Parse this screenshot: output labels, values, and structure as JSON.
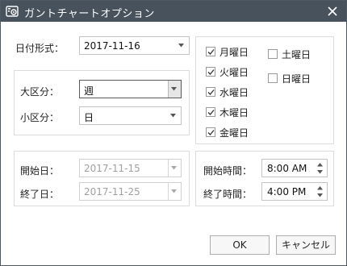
{
  "window": {
    "title": "ガントチャートオプション",
    "icon": "gantt-settings-icon"
  },
  "date_format": {
    "label": "日付形式：",
    "value": "2017-11-16"
  },
  "divisions": {
    "major_label": "大区分：",
    "major_value": "週",
    "minor_label": "小区分：",
    "minor_value": "日"
  },
  "weekdays": {
    "monday": "月曜日",
    "tuesday": "火曜日",
    "wednesday": "水曜日",
    "thursday": "木曜日",
    "friday": "金曜日",
    "saturday": "土曜日",
    "sunday": "日曜日"
  },
  "dates": {
    "start_label": "開始日：",
    "start_value": "2017-11-15",
    "end_label": "終了日：",
    "end_value": "2017-11-25"
  },
  "times": {
    "start_label": "開始時間：",
    "start_value": "8:00 AM",
    "end_label": "終了時間：",
    "end_value": "4:00 PM"
  },
  "buttons": {
    "ok": "OK",
    "cancel": "キャンセル"
  }
}
